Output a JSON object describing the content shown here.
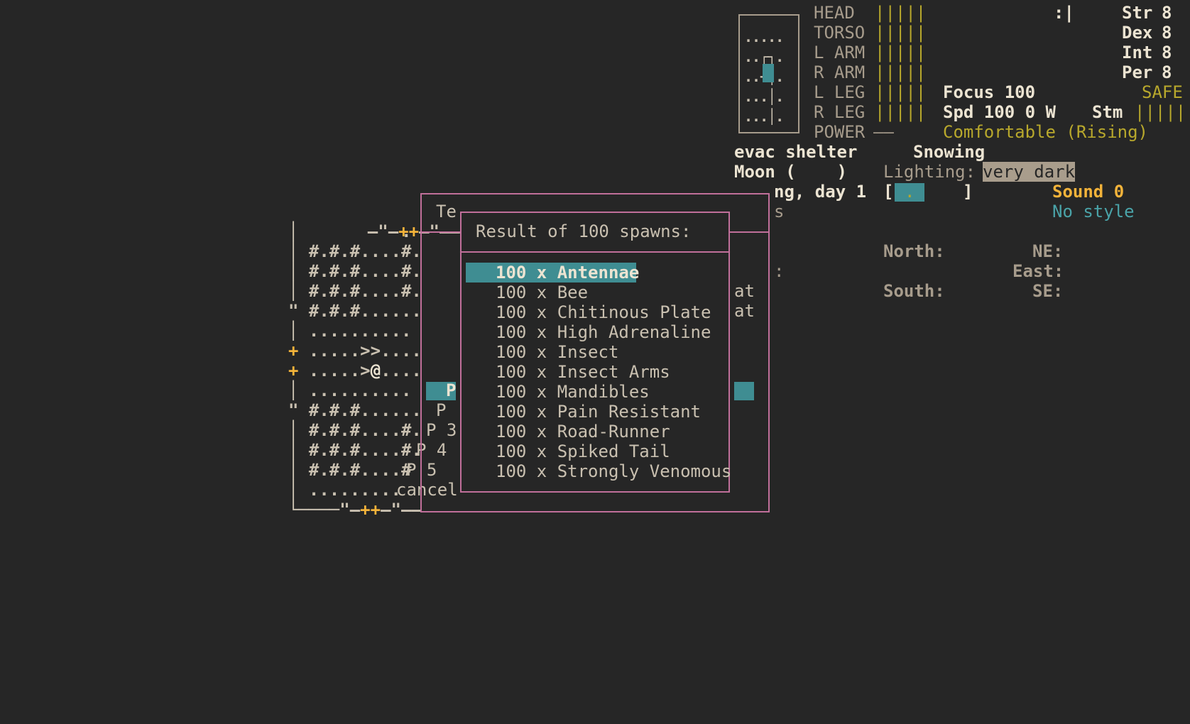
{
  "sidebar": {
    "body_parts": [
      {
        "label": "HEAD",
        "bar": "|||||"
      },
      {
        "label": "TORSO",
        "bar": "|||||"
      },
      {
        "label": "L ARM",
        "bar": "|||||"
      },
      {
        "label": "R ARM",
        "bar": "|||||"
      },
      {
        "label": "L LEG",
        "bar": "|||||"
      },
      {
        "label": "R LEG",
        "bar": "|||||"
      },
      {
        "label": "POWER",
        "bar": "——"
      }
    ],
    "mood": ":|",
    "stats": [
      {
        "label": "Str",
        "value": "8"
      },
      {
        "label": "Dex",
        "value": "8"
      },
      {
        "label": "Int",
        "value": "8"
      },
      {
        "label": "Per",
        "value": "8"
      }
    ],
    "focus": "Focus 100",
    "safe": "SAFE",
    "speed": "Spd 100 0 W",
    "stamina_label": "Stm",
    "stamina_bar": "|||||",
    "temperature": "Comfortable (Rising)",
    "location": "evac shelter",
    "weather": "Snowing",
    "moon": "Moon (    )",
    "lighting_label": "Lighting:",
    "lighting_value": "very dark",
    "date": "ng, day 1",
    "wield_open": "[",
    "wield_dot": ".",
    "wield_close": "]",
    "sound": "Sound 0",
    "style": "No style",
    "partial_s": "s",
    "partial_colon": ":",
    "partial_at1": "at",
    "partial_at2": "at",
    "compass": {
      "north": "North:",
      "ne": "NE:",
      "east": "East:",
      "south": "South:",
      "se": "SE:"
    },
    "minimap_rows": [
      ".....",
      "..┌┐.",
      "..+│.",
      "...│.",
      "...│."
    ]
  },
  "map": {
    "rows": [
      {
        "text": "—\"—++—\"——",
        "prefix": ""
      },
      {
        "text": "          .",
        "prefix": "│"
      },
      {
        "text": " #.#.#....#.",
        "prefix": "│"
      },
      {
        "text": " #.#.#....#.",
        "prefix": "│"
      },
      {
        "text": " #.#.#....#.",
        "prefix": "│"
      },
      {
        "text": " #.#.#......",
        "prefix": "\""
      },
      {
        "text": " ..........",
        "prefix": "│"
      },
      {
        "text": " .....>>....",
        "prefix": "+"
      },
      {
        "text": " .....>@....",
        "prefix": "+"
      },
      {
        "text": " ..........",
        "prefix": "│"
      },
      {
        "text": " #.#.#......",
        "prefix": "\""
      },
      {
        "text": " #.#.#....#.",
        "prefix": "│"
      },
      {
        "text": " #.#.#....#.",
        "prefix": "│"
      },
      {
        "text": " #.#.#....#",
        "prefix": "│"
      },
      {
        "text": " .........",
        "prefix": "│"
      },
      {
        "text": "└────\"—++—\"——",
        "prefix": ""
      }
    ],
    "side_labels": [
      "P",
      "P",
      "P 3",
      "P 4",
      "P 5",
      "cancel"
    ]
  },
  "outer_dialog": {
    "title_fragment": "Te"
  },
  "dialog": {
    "title": "Result of 100 spawns:",
    "items": [
      "100 x Antennae",
      "100 x Bee",
      "100 x Chitinous Plate",
      "100 x High Adrenaline",
      "100 x Insect",
      "100 x Insect Arms",
      "100 x Mandibles",
      "100 x Pain Resistant",
      "100 x Road-Runner",
      "100 x Spiked Tail",
      "100 x Strongly Venomous"
    ],
    "selected_index": 0
  }
}
